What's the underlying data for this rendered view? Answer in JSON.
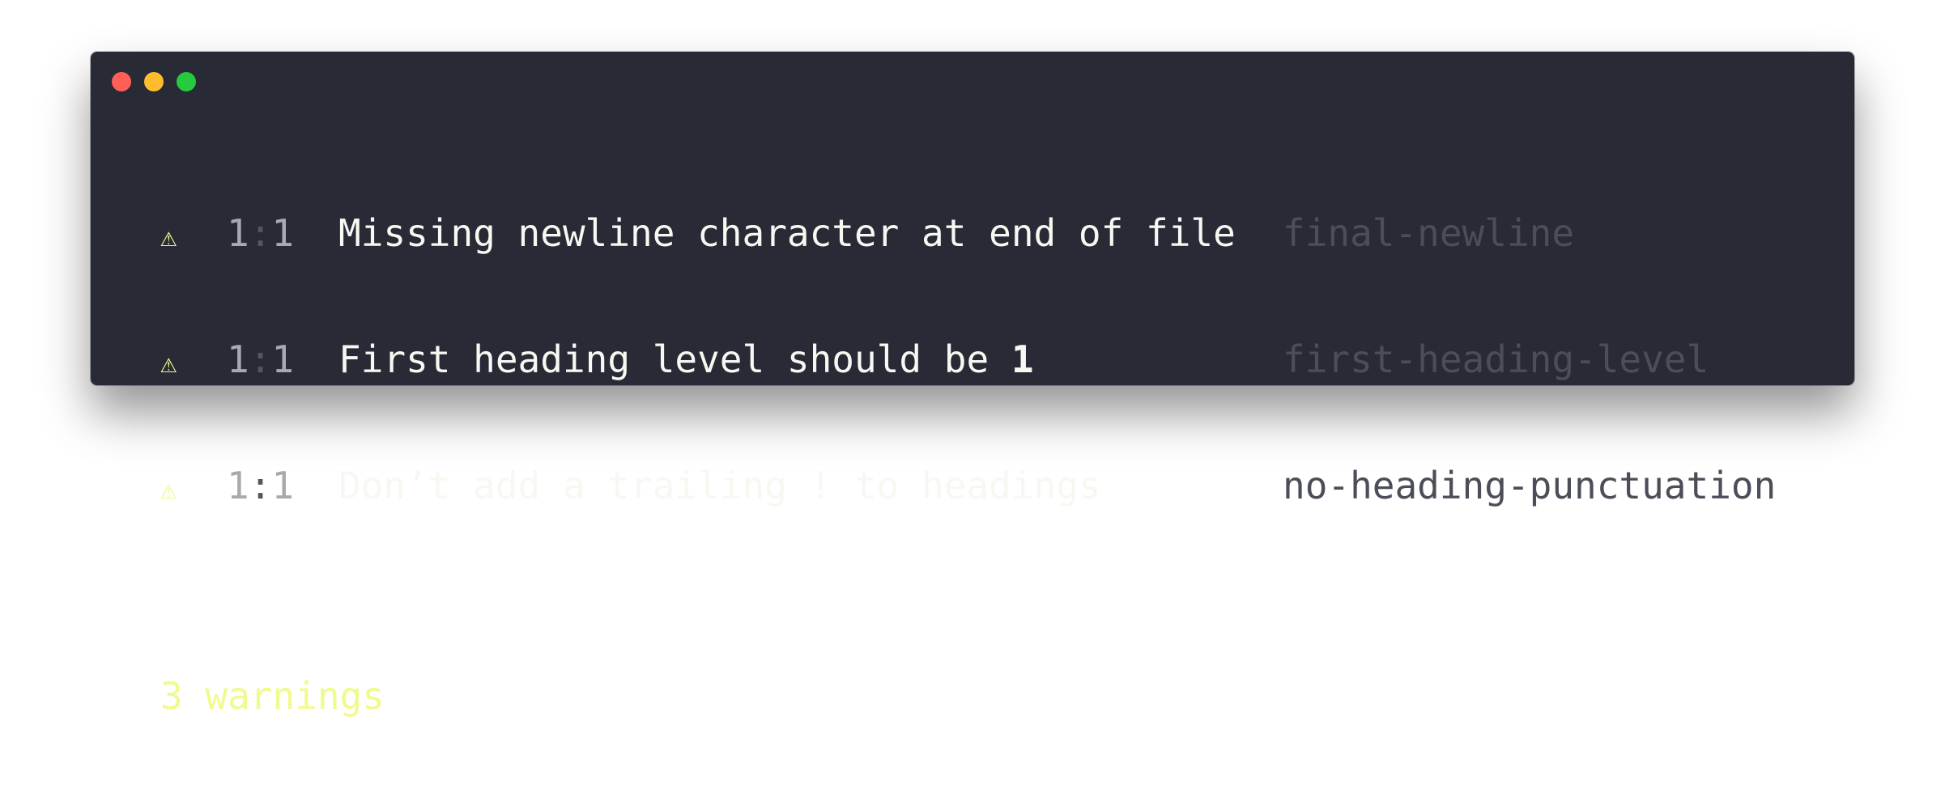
{
  "window": {
    "buttons": [
      "close",
      "minimize",
      "maximize"
    ]
  },
  "messages": [
    {
      "icon": "warning-icon",
      "glyph": "⚠",
      "line": "1",
      "separator": ":",
      "column": "1",
      "text": "Missing newline character at end of file",
      "emphasis": "",
      "rule": "final-newline"
    },
    {
      "icon": "warning-icon",
      "glyph": "⚠",
      "line": "1",
      "separator": ":",
      "column": "1",
      "text": "First heading level should be ",
      "emphasis": "1",
      "rule": "first-heading-level"
    },
    {
      "icon": "warning-icon",
      "glyph": "⚠",
      "line": "1",
      "separator": ":",
      "column": "1",
      "text": "Don’t add a trailing ! to headings",
      "emphasis": "",
      "rule": "no-heading-punctuation"
    }
  ],
  "summary": "3 warnings",
  "colors": {
    "background": "#282a36",
    "warning": "#f1fa8c",
    "text": "#f8f8f2",
    "rule": "#4b4d58"
  }
}
